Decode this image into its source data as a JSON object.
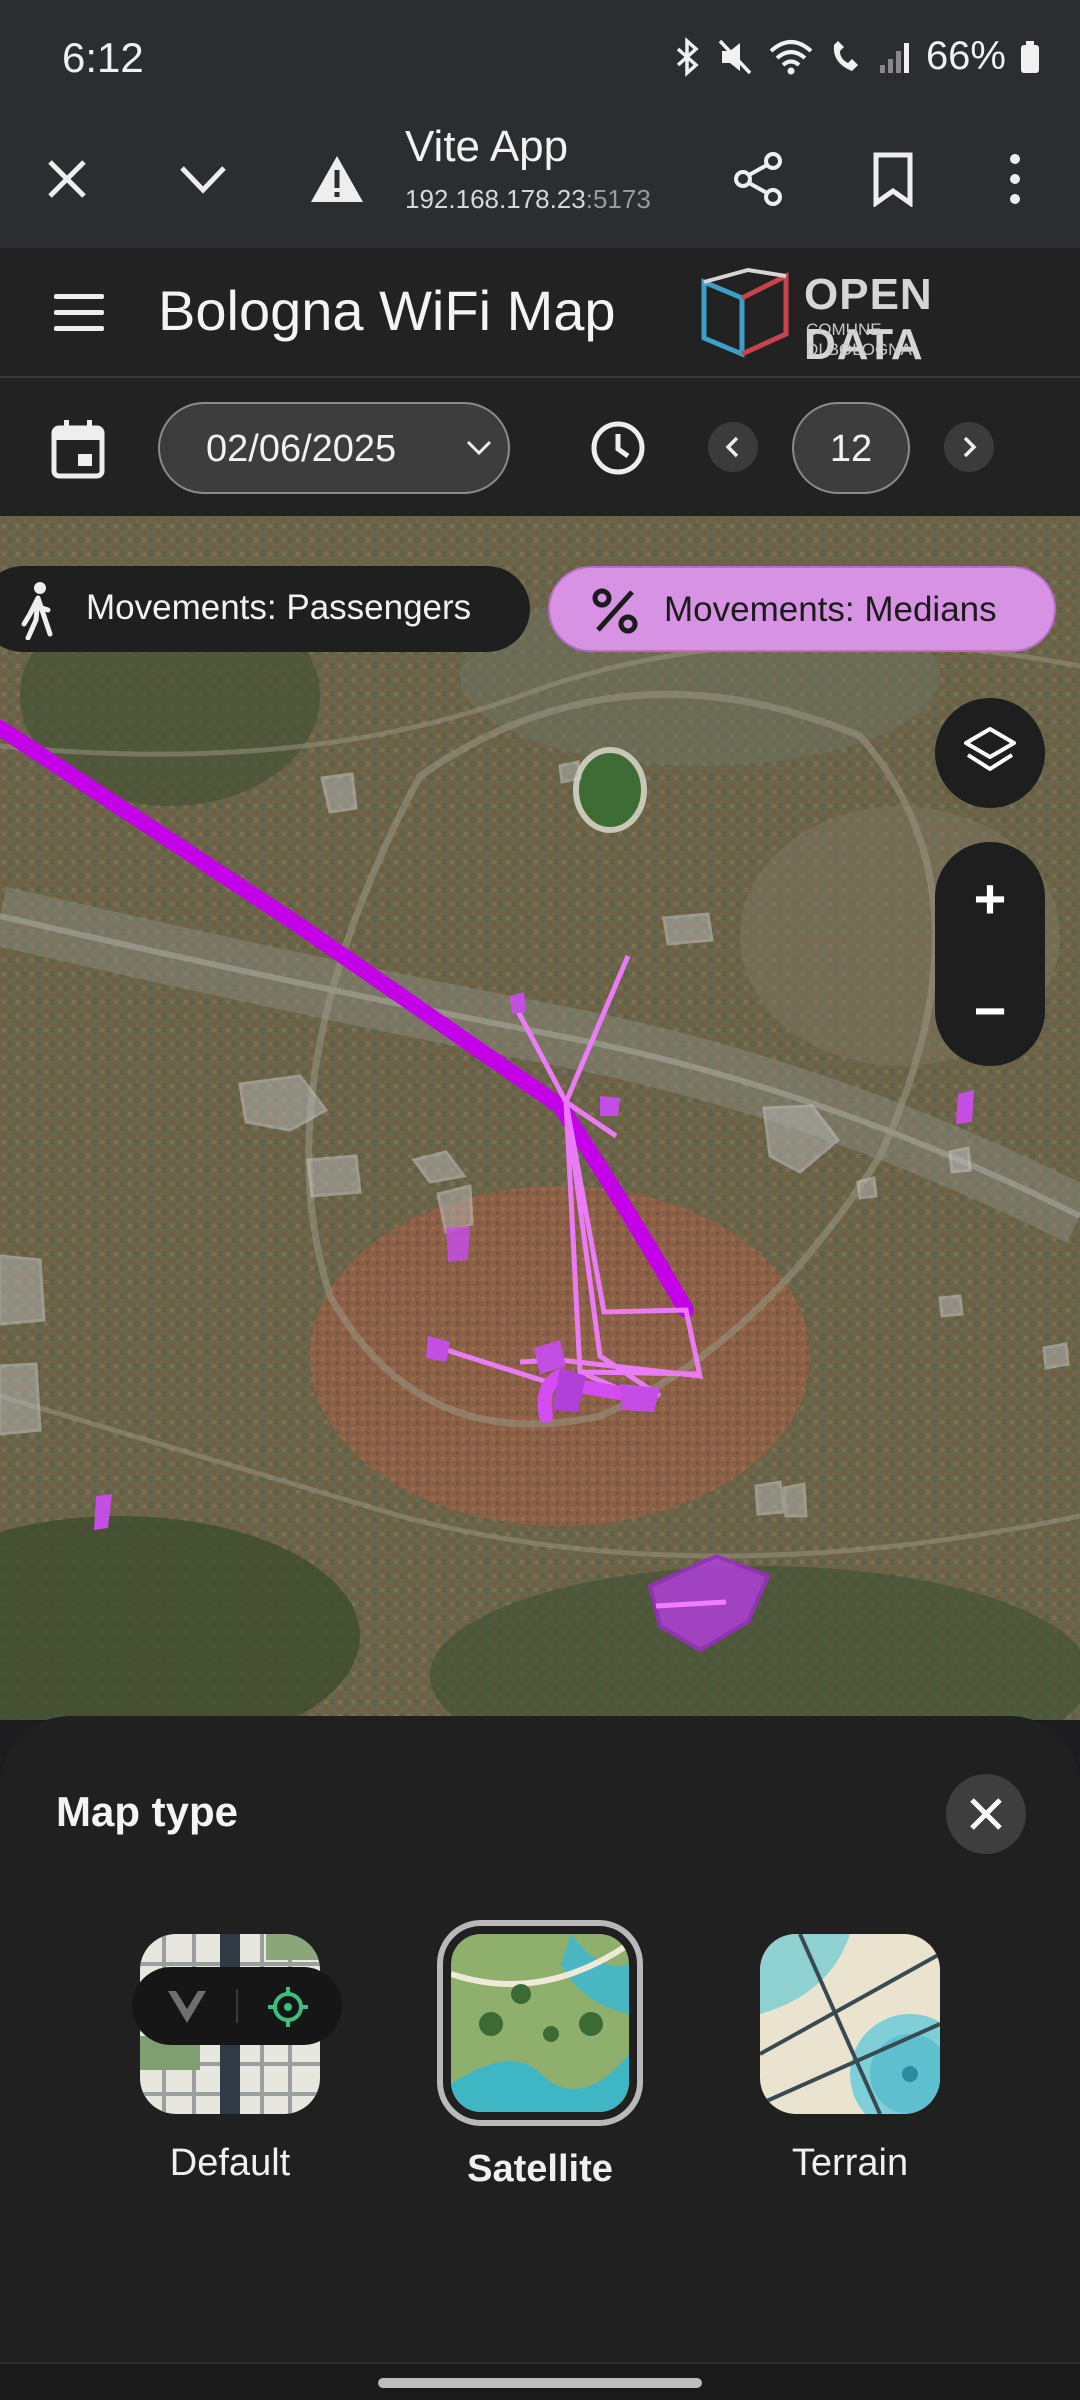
{
  "status_bar": {
    "time": "6:12",
    "battery": "66%"
  },
  "browser": {
    "title": "Vite App",
    "url_host": "192.168.178.23",
    "url_port": ":5173"
  },
  "header": {
    "title": "Bologna WiFi Map",
    "logo": {
      "title": "OPEN DATA",
      "line1": "COMUNE",
      "line2": "DI BOLOGNA"
    }
  },
  "controls": {
    "date": "02/06/2025",
    "hour": "12"
  },
  "chips": {
    "passengers": "Movements: Passengers",
    "medians": "Movements: Medians"
  },
  "map_controls": {
    "zoom_in": "+",
    "zoom_out": "−"
  },
  "sheet": {
    "title": "Map type",
    "options": [
      {
        "label": "Default",
        "selected": false
      },
      {
        "label": "Satellite",
        "selected": true
      },
      {
        "label": "Terrain",
        "selected": false
      }
    ]
  },
  "colors": {
    "accent_purple": "#c800e8",
    "chip_selected": "#d892e3",
    "flow_light": "#f07cff"
  }
}
